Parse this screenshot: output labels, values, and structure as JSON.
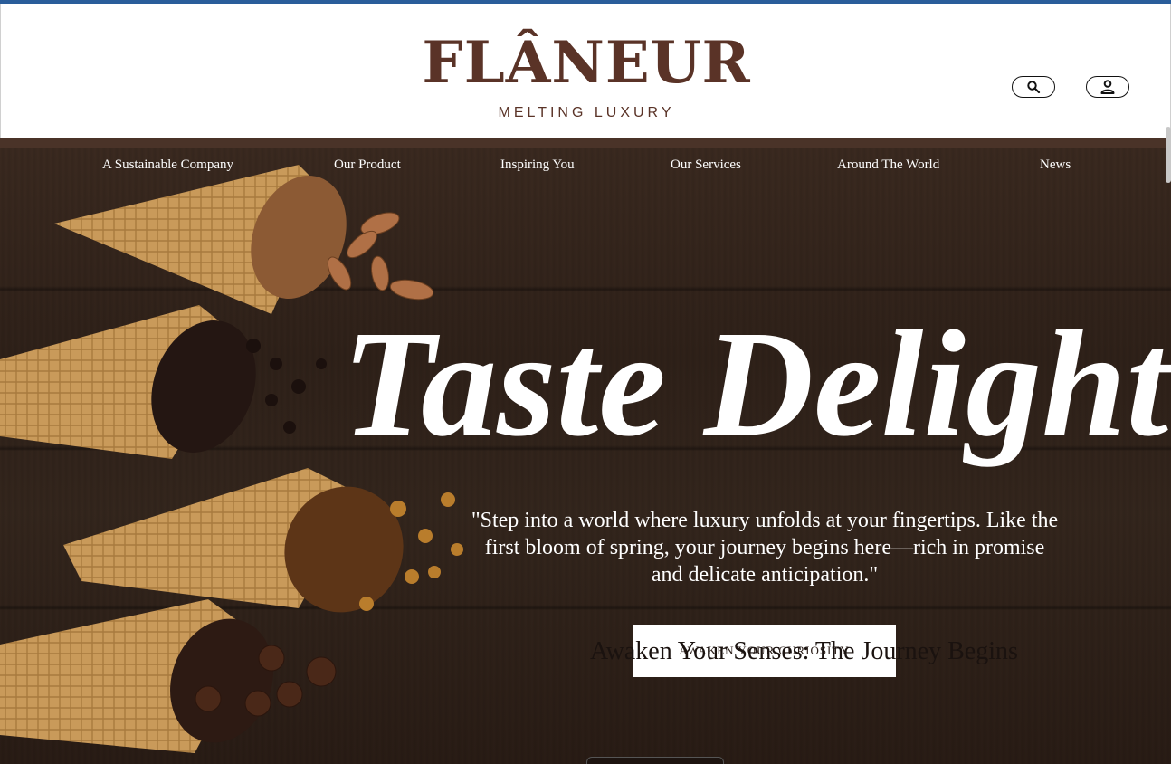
{
  "brand": {
    "name": "FLÂNEUR",
    "tagline": "MELTING LUXURY",
    "color": "#5a3327"
  },
  "header_icons": {
    "search": "search-icon",
    "account": "user-icon"
  },
  "nav": {
    "items": [
      "A Sustainable Company",
      "Our Product",
      "Inspiring You",
      "Our Services",
      "Around The World",
      "News"
    ]
  },
  "hero": {
    "title": "Taste Delight",
    "quote": "\"Step into a world where luxury unfolds at your fingertips. Like the first bloom of spring, your journey begins here—rich in promise and delicate anticipation.\"",
    "cta_small": "AWAKEN YOUR CURIOSITY",
    "cta_overlay": "Awaken Your Senses: The Journey Begins"
  },
  "colors": {
    "accent_brown": "#5a3327",
    "hero_text": "#ffffff"
  }
}
